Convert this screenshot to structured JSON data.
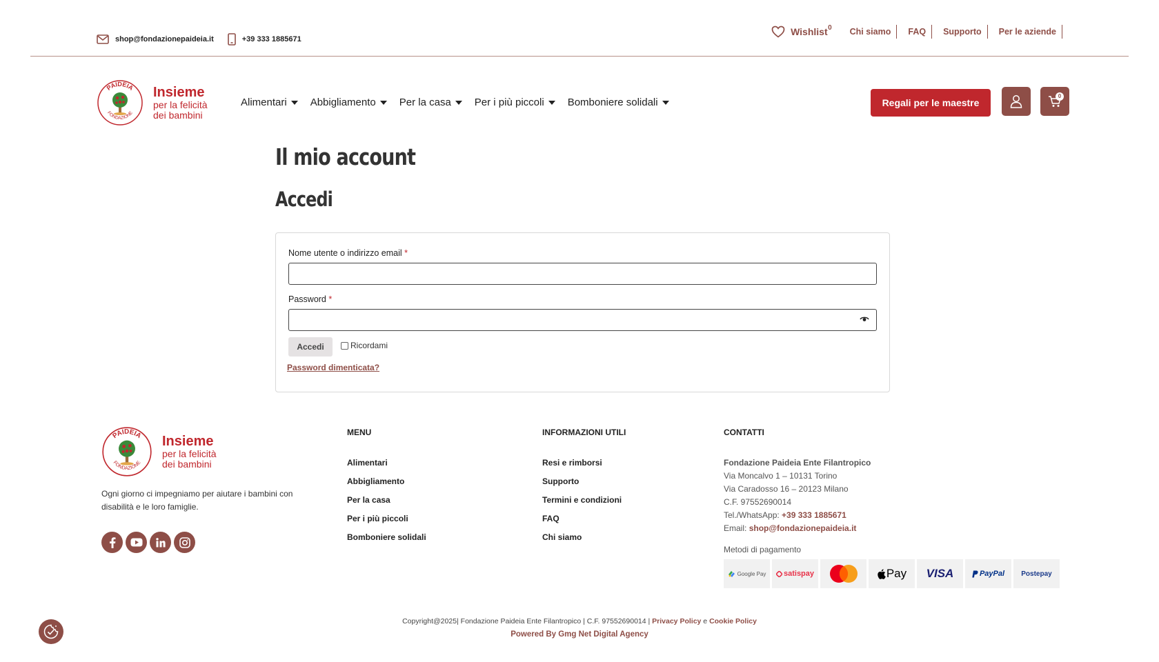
{
  "topbar": {
    "email": "shop@fondazionepaideia.it",
    "phone": "+39 333 1885671",
    "wishlist_label": "Wishlist",
    "wishlist_count": "0",
    "links": [
      "Chi siamo",
      "FAQ",
      "Supporto",
      "Per le aziende"
    ]
  },
  "logo": {
    "line1": "Insieme",
    "line2": "per la felicità",
    "line3": "dei bambini",
    "ring_top": "PAIDEIA",
    "ring_bottom": "FONDAZIONE"
  },
  "nav": [
    "Alimentari",
    "Abbigliamento",
    "Per la casa",
    "Per i più piccoli",
    "Bomboniere solidali"
  ],
  "header": {
    "cta_label": "Regali per le maestre",
    "cart_count": "0"
  },
  "main": {
    "page_title": "Il mio account",
    "login_title": "Accedi",
    "username_label": "Nome utente o indirizzo email",
    "password_label": "Password",
    "required_mark": "*",
    "username_value": "",
    "password_value": "",
    "submit_label": "Accedi",
    "remember_label": "Ricordami",
    "forgot_label": "Password dimenticata?"
  },
  "footer": {
    "description": "Ogni giorno ci impegniamo per aiutare i bambini con disabilità e le loro famiglie.",
    "socials": [
      "facebook-icon",
      "youtube-icon",
      "linkedin-icon",
      "instagram-icon"
    ],
    "menu_title": "MENU",
    "menu_items": [
      "Alimentari",
      "Abbigliamento",
      "Per la casa",
      "Per i più piccoli",
      "Bomboniere solidali"
    ],
    "info_title": "INFORMAZIONI UTILI",
    "info_items": [
      "Resi e rimborsi",
      "Supporto",
      "Termini e condizioni",
      "FAQ",
      "Chi siamo"
    ],
    "contacts_title": "CONTATTI",
    "org_name": "Fondazione Paideia Ente Filantropico",
    "address1": "Via Moncalvo 1 – 10131 Torino",
    "address2": "Via Caradosso 16 – 20123 Milano",
    "cf": "C.F. 97552690014",
    "tel_label": "Tel./WhatsApp:",
    "tel": "+39 333 1885671",
    "email_label": "Email:",
    "email": "shop@fondazionepaideia.it",
    "payment_label": "Metodi di pagamento",
    "payments": [
      "Google Pay",
      "satispay",
      "",
      "Pay",
      "VISA",
      "PayPal",
      "Postepay"
    ],
    "copyright_text": "Copyright@2025| Fondazione Paideia Ente Filantropico | C.F. 97552690014 |",
    "privacy_label": "Privacy Policy",
    "and_label": "e",
    "cookie_label": "Cookie Policy",
    "powered_by": "Powered By Gmg Net Digital Agency"
  },
  "colors": {
    "brand_red": "#c0272d",
    "brand_brown": "#8e4e47"
  }
}
